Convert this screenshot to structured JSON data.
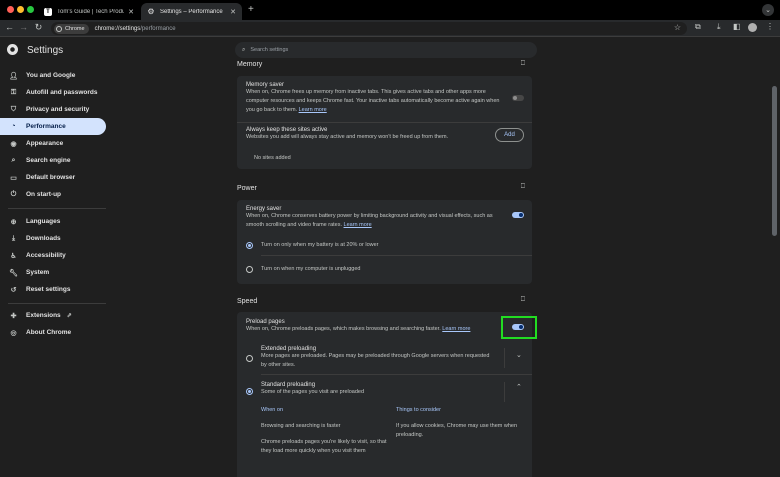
{
  "browser": {
    "tabs": [
      {
        "title": "Tom's Guide | Tech Product R",
        "favicon": "T"
      },
      {
        "title": "Settings – Performance",
        "favicon": "gear-icon"
      }
    ],
    "new_tab": "+",
    "omnibox": {
      "chip_label": "Chrome",
      "url_host": "chrome://settings",
      "url_path": "/performance"
    }
  },
  "settings": {
    "title": "Settings",
    "search_placeholder": "Search settings",
    "sidebar": [
      {
        "label": "You and Google",
        "icon": "person-icon"
      },
      {
        "label": "Autofill and passwords",
        "icon": "key-icon"
      },
      {
        "label": "Privacy and security",
        "icon": "shield-icon"
      },
      {
        "label": "Performance",
        "icon": "speedometer-icon",
        "active": true
      },
      {
        "label": "Appearance",
        "icon": "palette-icon"
      },
      {
        "label": "Search engine",
        "icon": "search-icon"
      },
      {
        "label": "Default browser",
        "icon": "browser-icon"
      },
      {
        "label": "On start-up",
        "icon": "power-icon"
      },
      {
        "label": "Languages",
        "icon": "globe-icon"
      },
      {
        "label": "Downloads",
        "icon": "download-icon"
      },
      {
        "label": "Accessibility",
        "icon": "accessibility-icon"
      },
      {
        "label": "System",
        "icon": "wrench-icon"
      },
      {
        "label": "Reset settings",
        "icon": "history-icon"
      },
      {
        "label": "Extensions",
        "icon": "puzzle-icon"
      },
      {
        "label": "About Chrome",
        "icon": "chrome-icon"
      }
    ]
  },
  "memory": {
    "heading": "Memory",
    "saver_title": "Memory saver",
    "saver_desc": "When on, Chrome frees up memory from inactive tabs. This gives active tabs and other apps more computer resources and keeps Chrome fast. Your inactive tabs automatically become active again when you go back to them.",
    "saver_link": "Learn more",
    "saver_enabled": false,
    "keep_title": "Always keep these sites active",
    "keep_desc": "Websites you add will always stay active and memory won't be freed up from them.",
    "add_label": "Add",
    "no_sites": "No sites added"
  },
  "power": {
    "heading": "Power",
    "saver_title": "Energy saver",
    "saver_desc": "When on, Chrome conserves battery power by limiting background activity and visual effects, such as smooth scrolling and video frame rates.",
    "saver_link": "Learn more",
    "saver_enabled": true,
    "option_battery": "Turn on only when my battery is at 20% or lower",
    "option_unplugged": "Turn on when my computer is unplugged"
  },
  "speed": {
    "heading": "Speed",
    "preload_title": "Preload pages",
    "preload_desc": "When on, Chrome preloads pages, which makes browsing and searching faster.",
    "preload_link": "Learn more",
    "preload_enabled": true,
    "extended_title": "Extended preloading",
    "extended_desc": "More pages are preloaded. Pages may be preloaded through Google servers when requested by other sites.",
    "standard_title": "Standard preloading",
    "standard_desc": "Some of the pages you visit are preloaded",
    "when_on_heading": "When on",
    "consider_heading": "Things to consider",
    "when_on_1": "Browsing and searching is faster",
    "when_on_2": "Chrome preloads pages you're likely to visit, so that they load more quickly when you visit them",
    "consider_1": "If you allow cookies, Chrome may use them when preloading."
  },
  "colors": {
    "accent": "#a8c7fa",
    "highlight": "#22dd22",
    "active_nav": "#d3e3fd"
  }
}
